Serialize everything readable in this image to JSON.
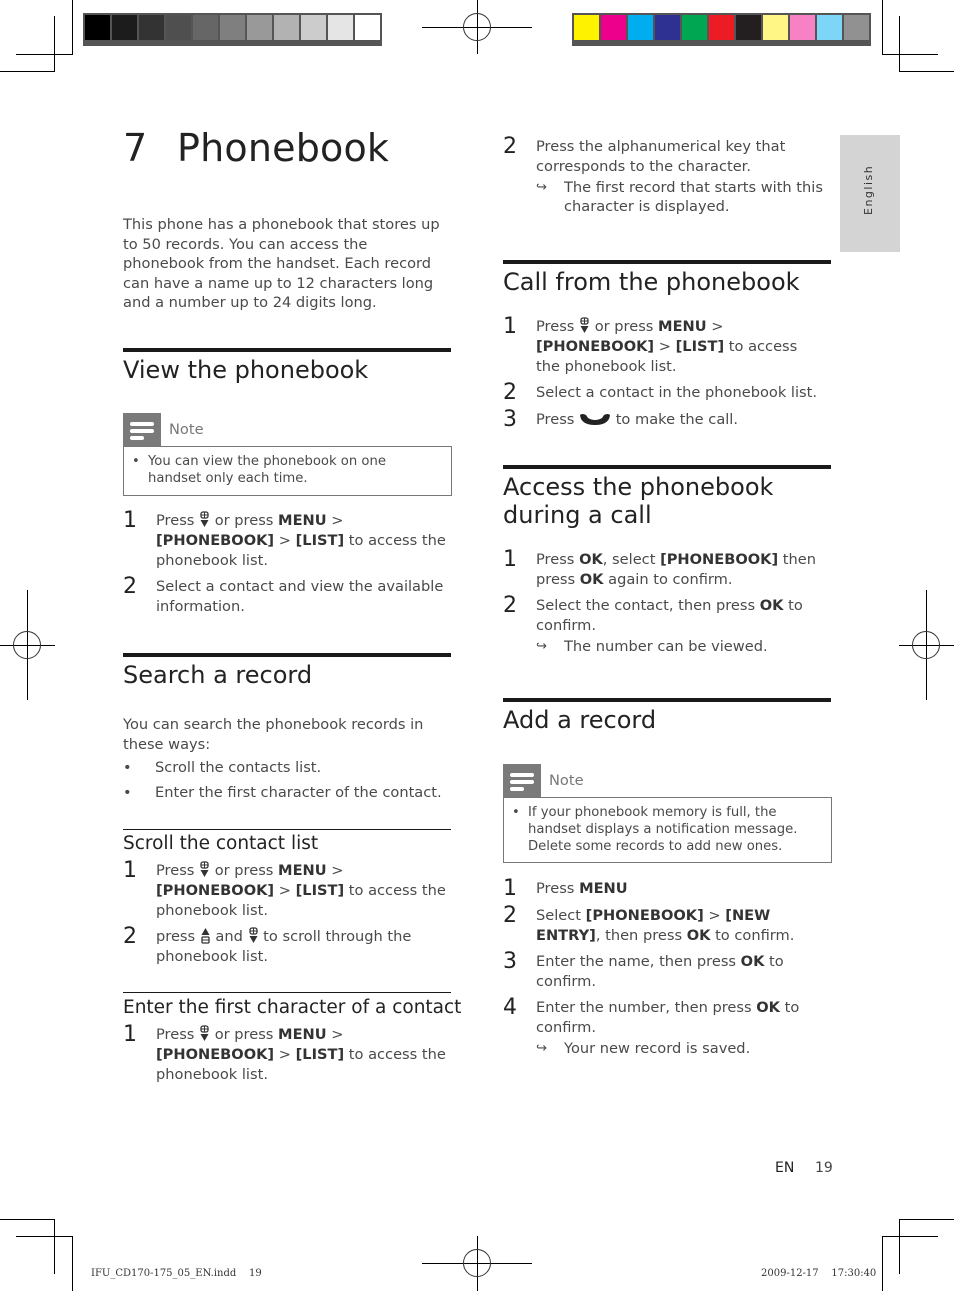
{
  "print_marks": {
    "grayscale_swatches": [
      "#000000",
      "#1c1c1c",
      "#333333",
      "#4f4f4f",
      "#666666",
      "#7f7f7f",
      "#999999",
      "#b2b2b2",
      "#cccccc",
      "#e5e5e5",
      "#ffffff"
    ],
    "color_swatches": [
      "#fff200",
      "#ec008c",
      "#00aeef",
      "#2e3192",
      "#00a651",
      "#ed1c24",
      "#231f20",
      "#fff685",
      "#f682c5",
      "#7dd6f7",
      "#919191"
    ]
  },
  "chapter": {
    "number": "7",
    "title": "Phonebook"
  },
  "intro": "This phone has a phonebook that stores up to 50 records. You can access the phonebook from the handset. Each record can have a name up to 12 characters long and a number up to 24 digits long.",
  "sidebar_tab": "English",
  "left": {
    "view": {
      "heading": "View the phonebook",
      "note_label": "Note",
      "note_text": "You can view the phonebook on one handset only each time.",
      "steps": [
        {
          "n": "1",
          "pre": "Press",
          "mid": "or press",
          "b1": "MENU",
          "s1": " >",
          "b2": "[PHONEBOOK]",
          "s2": " > ",
          "b3": "[LIST]",
          "post": " to access the phonebook list."
        },
        {
          "n": "2",
          "text": "Select a contact and view the available information."
        }
      ]
    },
    "search": {
      "heading": "Search a record",
      "intro": "You can search the phonebook records in these ways:",
      "bullets": [
        "Scroll the contacts list.",
        "Enter the first character of the contact."
      ]
    },
    "scroll": {
      "heading": "Scroll the contact list",
      "steps": [
        {
          "n": "1",
          "pre": "Press",
          "mid": "or press",
          "b1": "MENU",
          "s1": " >",
          "b2": "[PHONEBOOK]",
          "s2": " > ",
          "b3": "[LIST]",
          "post": " to access the phonebook list."
        },
        {
          "n": "2",
          "pre": "press",
          "mid": "and",
          "post": "to scroll through the phonebook list."
        }
      ]
    },
    "enter": {
      "heading": "Enter the first character of a contact",
      "steps": [
        {
          "n": "1",
          "pre": "Press",
          "mid": "or press",
          "b1": "MENU",
          "s1": " >",
          "b2": "[PHONEBOOK]",
          "s2": " > ",
          "b3": "[LIST]",
          "post": " to access the phonebook list."
        }
      ]
    }
  },
  "right": {
    "enter_cont": {
      "n": "2",
      "text": "Press the alphanumerical key that corresponds to the character.",
      "result": "The first record that starts with this character is displayed."
    },
    "call": {
      "heading": "Call from the phonebook",
      "steps": [
        {
          "n": "1",
          "pre": "Press",
          "mid": "or press",
          "b1": "MENU",
          "s1": " >",
          "b2": "[PHONEBOOK]",
          "s2": " > ",
          "b3": "[LIST]",
          "post": " to access the phonebook list."
        },
        {
          "n": "2",
          "text": "Select a contact in the phonebook list."
        },
        {
          "n": "3",
          "pre": "Press",
          "post": "to make the call."
        }
      ]
    },
    "during": {
      "heading": "Access the phonebook during a call",
      "steps": [
        {
          "n": "1",
          "a": "Press ",
          "b1": "OK",
          "c": ", select ",
          "b2": "[PHONEBOOK]",
          "d": " then press ",
          "b3": "OK",
          "e": " again to confirm."
        },
        {
          "n": "2",
          "a": "Select the contact, then press ",
          "b1": "OK",
          "c": " to confirm.",
          "result": "The number can be viewed."
        }
      ]
    },
    "add": {
      "heading": "Add a record",
      "note_label": "Note",
      "note_text": "If your phonebook memory is full, the handset displays a notification message. Delete some records to add new ones.",
      "steps": [
        {
          "n": "1",
          "a": "Press ",
          "b1": "MENU"
        },
        {
          "n": "2",
          "a": "Select ",
          "b1": "[PHONEBOOK]",
          "c": " > ",
          "b2": "[NEW ENTRY]",
          "d": ", then press ",
          "b3": "OK",
          "e": " to confirm."
        },
        {
          "n": "3",
          "a": "Enter the name, then press ",
          "b1": "OK",
          "c": " to confirm."
        },
        {
          "n": "4",
          "a": "Enter the number, then press ",
          "b1": "OK",
          "c": " to confirm.",
          "result": "Your new record is saved."
        }
      ]
    }
  },
  "footer": {
    "lang": "EN",
    "page": "19",
    "slug_file": "IFU_CD170-175_05_EN.indd",
    "slug_page": "19",
    "slug_date": "2009-12-17",
    "slug_time": "17:30:40"
  }
}
